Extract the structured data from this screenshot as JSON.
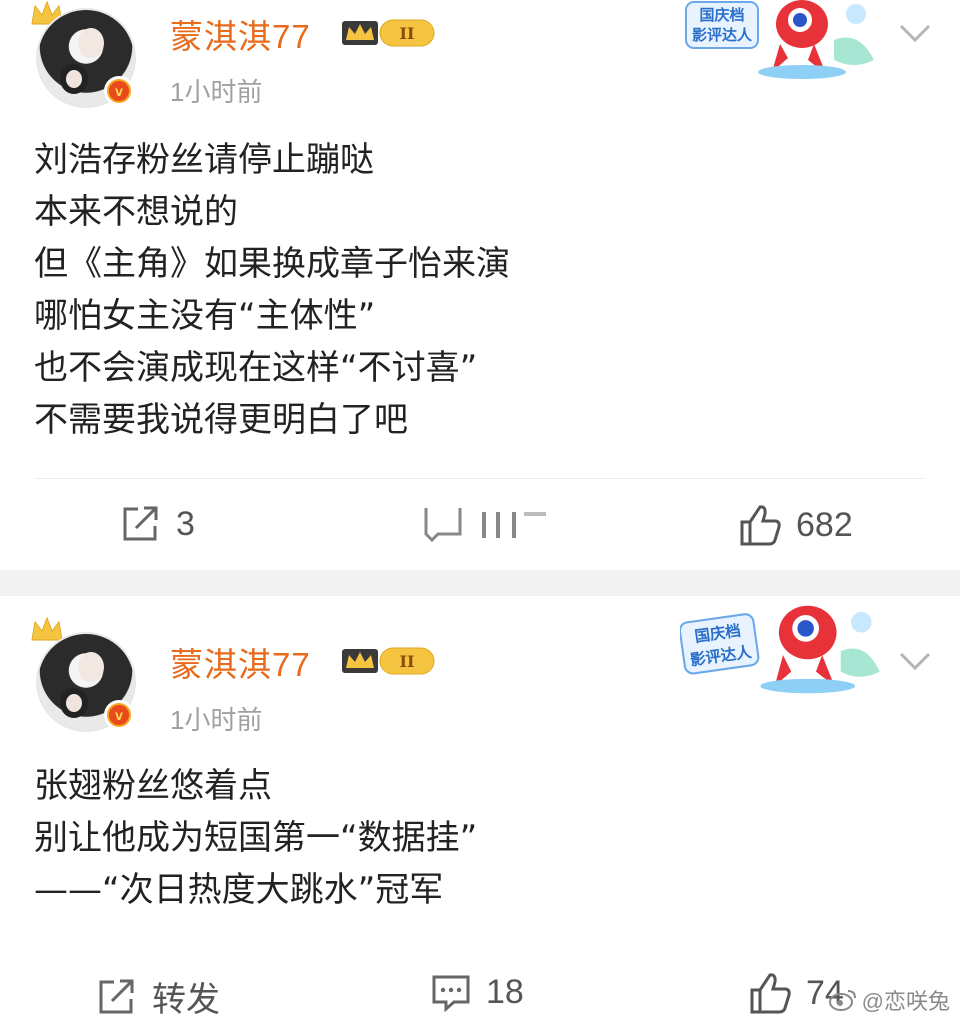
{
  "posts": [
    {
      "username": "蒙淇淇77",
      "vip_level": "II",
      "time": "1小时前",
      "sticker_text": [
        "国庆档",
        "影评达人"
      ],
      "lines": [
        "刘浩存粉丝请停止蹦哒",
        "本来不想说的",
        "但《主角》如果换成章子怡来演",
        "哪怕女主没有“主体性”",
        "也不会演成现在这样“不讨喜”",
        "不需要我说得更明白了吧"
      ],
      "repost_count": "3",
      "like_count": "682"
    },
    {
      "username": "蒙淇淇77",
      "vip_level": "II",
      "time": "1小时前",
      "sticker_text": [
        "国庆档",
        "影评达人"
      ],
      "lines": [
        "张翅粉丝悠着点",
        "别让他成为短国第一“数据挂”",
        "——“次日热度大跳水”冠军"
      ],
      "repost_label": "转发",
      "comment_count": "18",
      "like_count": "74"
    }
  ],
  "watermark": "@恋咲兔",
  "colors": {
    "username": "#e86a1a",
    "meta": "#a0a0a0",
    "text": "#222222",
    "divider": "#f2f2f2"
  }
}
